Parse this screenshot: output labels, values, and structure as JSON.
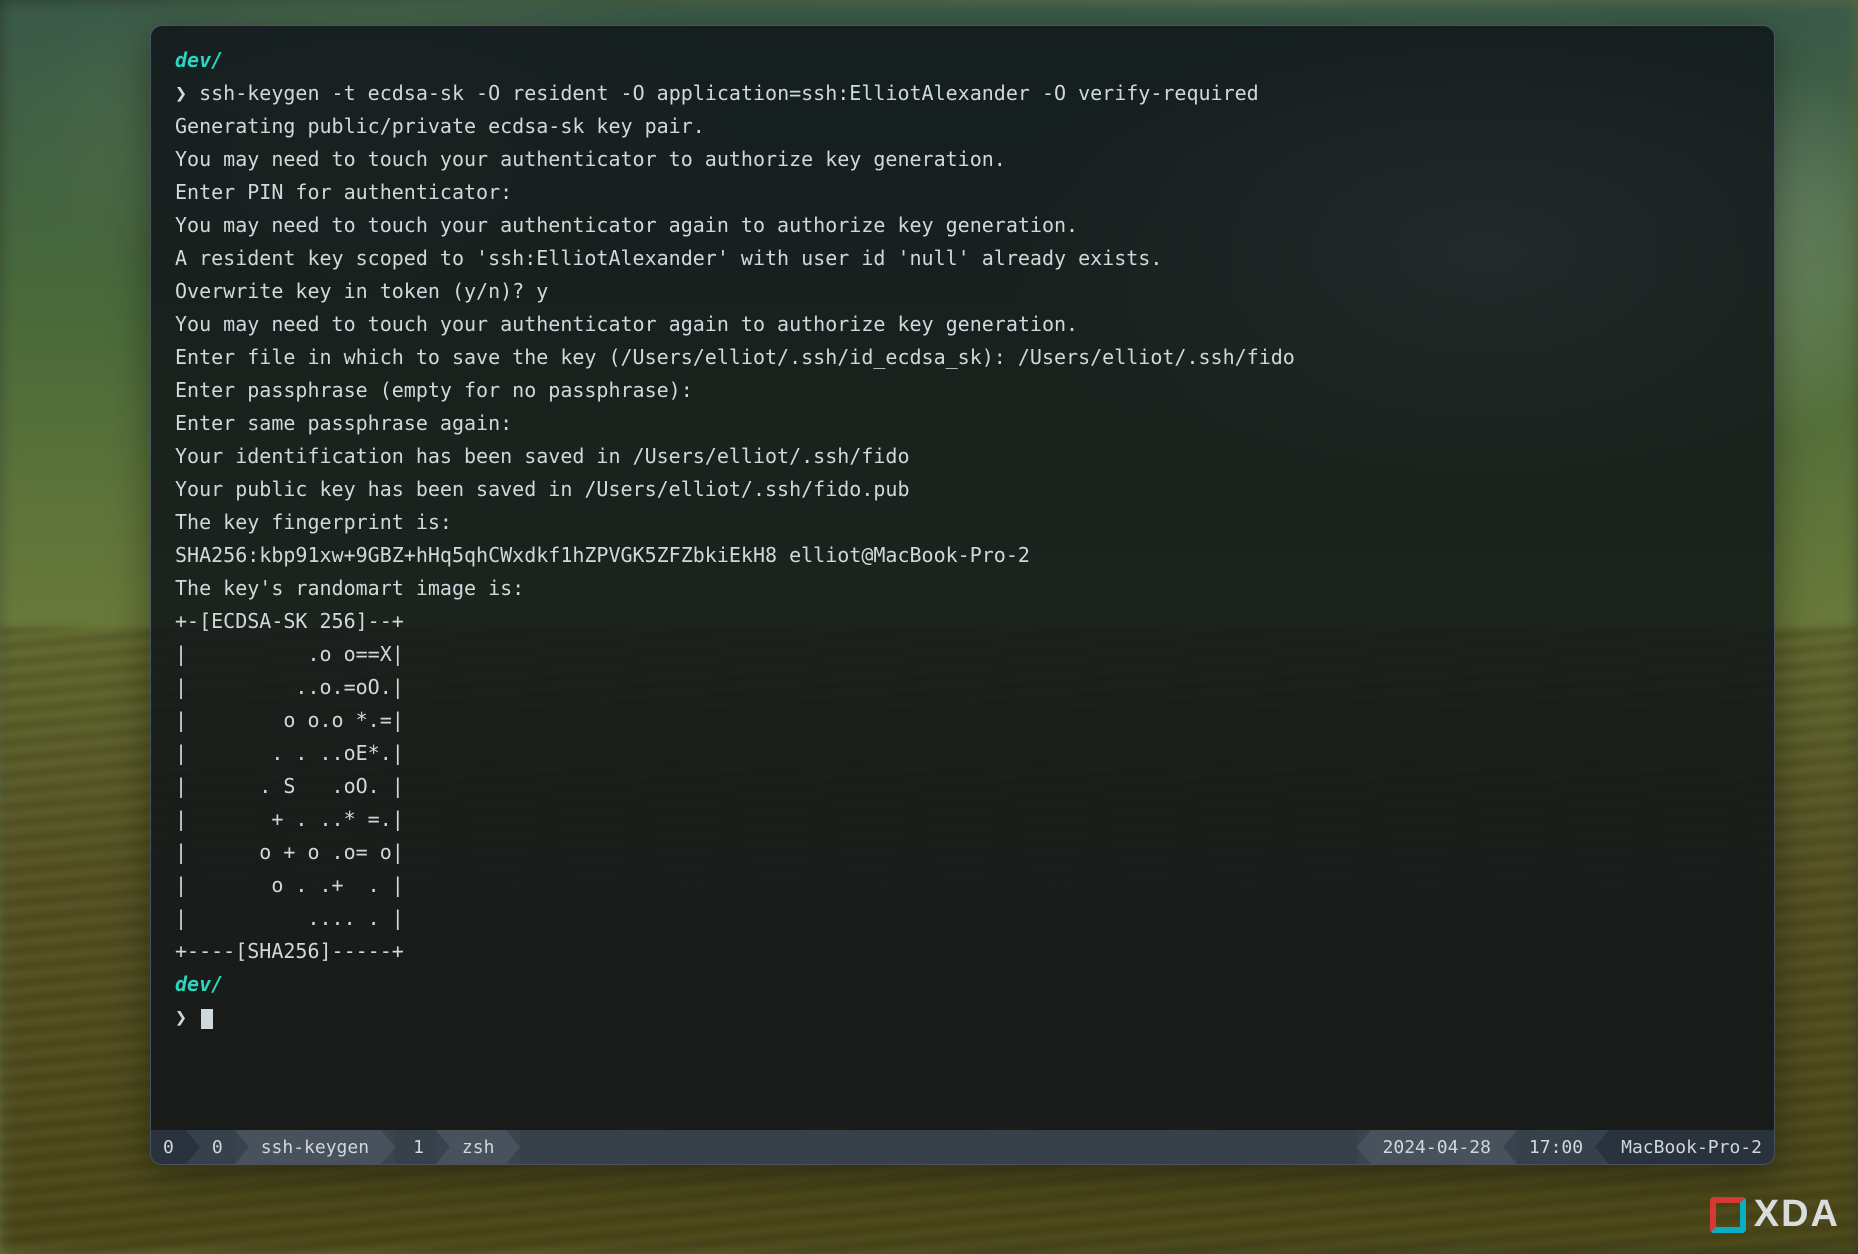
{
  "prompt1": {
    "path": "dev/",
    "symbol": "❯",
    "command": "ssh-keygen -t ecdsa-sk -O resident -O application=ssh:ElliotAlexander -O verify-required"
  },
  "output_lines": [
    "Generating public/private ecdsa-sk key pair.",
    "You may need to touch your authenticator to authorize key generation.",
    "Enter PIN for authenticator:",
    "You may need to touch your authenticator again to authorize key generation.",
    "A resident key scoped to 'ssh:ElliotAlexander' with user id 'null' already exists.",
    "Overwrite key in token (y/n)? y",
    "You may need to touch your authenticator again to authorize key generation.",
    "Enter file in which to save the key (/Users/elliot/.ssh/id_ecdsa_sk): /Users/elliot/.ssh/fido",
    "Enter passphrase (empty for no passphrase):",
    "Enter same passphrase again:",
    "Your identification has been saved in /Users/elliot/.ssh/fido",
    "Your public key has been saved in /Users/elliot/.ssh/fido.pub",
    "The key fingerprint is:",
    "SHA256:kbp91xw+9GBZ+hHq5qhCWxdkf1hZPVGK5ZFZbkiEkH8 elliot@MacBook-Pro-2",
    "The key's randomart image is:",
    "+-[ECDSA-SK 256]--+",
    "|          .o o==X|",
    "|         ..o.=oO.|",
    "|        o o.o *.=|",
    "|       . . ..oE*.|",
    "|      . S   .oO. |",
    "|       + . ..* =.|",
    "|      o + o .o= o|",
    "|       o . .+  . |",
    "|          .... . |",
    "+----[SHA256]-----+"
  ],
  "prompt2": {
    "path": "dev/",
    "symbol": "❯"
  },
  "statusbar": {
    "left": {
      "session_index": "0",
      "window_index": "0",
      "window_name": "ssh-keygen",
      "pane_index": "1",
      "shell": "zsh"
    },
    "right": {
      "date": "2024-04-28",
      "time": "17:00",
      "host": "MacBook-Pro-2"
    }
  },
  "watermark": {
    "text": "XDA"
  }
}
